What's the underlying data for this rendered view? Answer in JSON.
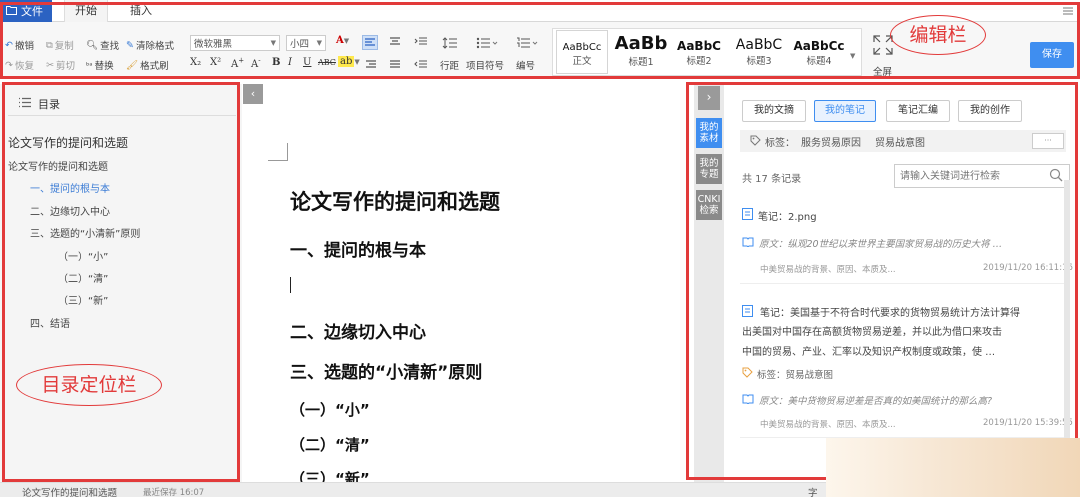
{
  "menu": {
    "file_label": "文件",
    "tabs": [
      "开始",
      "插入"
    ]
  },
  "ribbon": {
    "undo": "撤销",
    "redo": "恢复",
    "copy": "复制",
    "cut": "剪切",
    "find": "查找",
    "replace": "替换",
    "clear_format": "清除格式",
    "format_painter": "格式刷",
    "font_name": "微软雅黑",
    "font_size": "小四",
    "line_spacing": "行距",
    "bullets": "项目符号",
    "numbering": "编号",
    "styles": [
      {
        "sample": "AaBbCc",
        "label": "正文"
      },
      {
        "sample": "AaBb",
        "label": "标题1"
      },
      {
        "sample": "AaBbC",
        "label": "标题2"
      },
      {
        "sample": "AaBbC",
        "label": "标题3"
      },
      {
        "sample": "AaBbCc",
        "label": "标题4"
      }
    ],
    "fullscreen": "全屏",
    "save": "保存"
  },
  "annotations": {
    "edit_bar": "编辑栏",
    "toc_bar": "目录定位栏"
  },
  "toc": {
    "title": "目录",
    "items": [
      {
        "text": "论文写作的提问和选题",
        "level": 0
      },
      {
        "text": "论文写作的提问和选题",
        "level": 1
      },
      {
        "text": "一、提问的根与本",
        "level": 2
      },
      {
        "text": "二、边缘切入中心",
        "level": 2
      },
      {
        "text": "三、选题的“小清新”原则",
        "level": 2
      },
      {
        "text": "（一）“小”",
        "level": 3
      },
      {
        "text": "（二）“清”",
        "level": 3
      },
      {
        "text": "（三）“新”",
        "level": 3
      },
      {
        "text": "四、结语",
        "level": 2
      }
    ]
  },
  "document": {
    "title": "论文写作的提问和选题",
    "h1": "一、提问的根与本",
    "h2": "二、边缘切入中心",
    "h3": "三、选题的“小清新”原则",
    "sub1": "（一）“小”",
    "sub2": "（二）“清”",
    "sub3": "（三）“新”"
  },
  "right": {
    "side_tabs": [
      "我的素材",
      "我的专题",
      "CNKI检索"
    ],
    "tabs": [
      "我的文摘",
      "我的笔记",
      "笔记汇编",
      "我的创作"
    ],
    "tag_label": "标签：",
    "tags": [
      "服务贸易原因",
      "贸易战意图"
    ],
    "more": "···",
    "record_count": "共 17 条记录",
    "search_placeholder": "请输入关键词进行检索",
    "notes": [
      {
        "title": "笔记：2.png",
        "quote": "原文：纵观20世纪以来世界主要国家贸易战的历史大将 …",
        "source": "中美贸易战的背景、原因、本质及...",
        "time": "2019/11/20 16:11:16"
      },
      {
        "lines": [
          "笔记：美国基于不符合时代要求的货物贸易统计方法计算得",
          "出美国对中国存在高额货物贸易逆差，并以此为借口来攻击",
          "中国的贸易、产业、汇率以及知识产权制度或政策，使 …"
        ],
        "tag": "标签：贸易战意图",
        "quote": "原文：美中货物贸易逆差是否真的如美国统计的那么高?",
        "source": "中美贸易战的背景、原因、本质及...",
        "time": "2019/11/20 15:39:55"
      }
    ]
  },
  "status": {
    "doc_name": "论文写作的提问和选题",
    "last_saved": "最近保存 16:07",
    "right_text": "字"
  },
  "colors": {
    "accent": "#3f8ef0",
    "file_tab": "#2b62c2",
    "annotation_red": "#e23a3a"
  }
}
